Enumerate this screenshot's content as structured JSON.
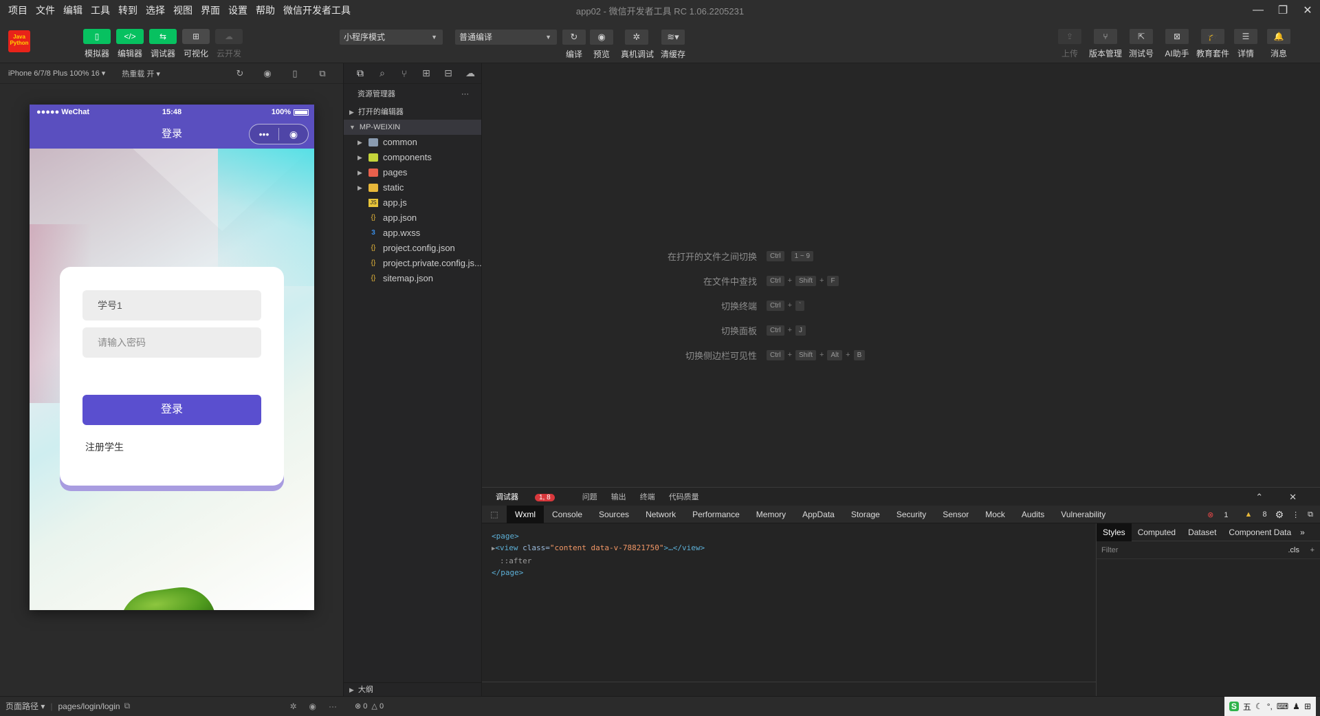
{
  "menubar": {
    "items": [
      "项目",
      "文件",
      "编辑",
      "工具",
      "转到",
      "选择",
      "视图",
      "界面",
      "设置",
      "帮助",
      "微信开发者工具"
    ],
    "title": "app02 - 微信开发者工具 RC 1.06.2205231"
  },
  "toolbar": {
    "logo_text": "Java Python",
    "simulator": "模拟器",
    "editor": "编辑器",
    "debugger": "调试器",
    "visual": "可视化",
    "cloud": "云开发",
    "mode_select": "小程序模式",
    "compile_select": "普通编译",
    "compile": "编译",
    "preview": "预览",
    "real_debug": "真机调试",
    "clear_cache": "清缓存",
    "upload": "上传",
    "version": "版本管理",
    "test_account": "测试号",
    "ai": "AI助手",
    "edu": "教育套件",
    "details": "详情",
    "messages": "消息"
  },
  "simulator": {
    "device": "iPhone 6/7/8 Plus 100% 16",
    "hot_reload": "热重载 开",
    "status_left": "●●●●● WeChat",
    "status_time": "15:48",
    "status_battery": "100%",
    "nav_title": "登录",
    "capsule_more": "•••",
    "capsule_close": "◉",
    "student_id_value": "学号1",
    "password_placeholder": "请输入密码",
    "login_button": "登录",
    "register_link": "注册学生"
  },
  "explorer": {
    "header": "资源管理器",
    "more": "···",
    "open_editors": "打开的编辑器",
    "project": "MP-WEIXIN",
    "items": [
      {
        "name": "common",
        "type": "folder",
        "color": "#8a9bb0"
      },
      {
        "name": "components",
        "type": "folder",
        "color": "#c4d43a"
      },
      {
        "name": "pages",
        "type": "folder",
        "color": "#e8604c"
      },
      {
        "name": "static",
        "type": "folder",
        "color": "#e8b83a"
      },
      {
        "name": "app.js",
        "type": "js",
        "color": "#e8c53a"
      },
      {
        "name": "app.json",
        "type": "json",
        "color": "#e8b83a"
      },
      {
        "name": "app.wxss",
        "type": "wxss",
        "color": "#3a8ee8"
      },
      {
        "name": "project.config.json",
        "type": "json",
        "color": "#e8b83a"
      },
      {
        "name": "project.private.config.js...",
        "type": "json",
        "color": "#e8b83a"
      },
      {
        "name": "sitemap.json",
        "type": "json",
        "color": "#e8b83a"
      }
    ],
    "outline": "大纲"
  },
  "shortcuts": [
    {
      "label": "在打开的文件之间切换",
      "keys": [
        "Ctrl",
        "1 ~ 9"
      ]
    },
    {
      "label": "在文件中查找",
      "keys": [
        "Ctrl",
        "+",
        "Shift",
        "+",
        "F"
      ]
    },
    {
      "label": "切换终端",
      "keys": [
        "Ctrl",
        "+",
        "`"
      ]
    },
    {
      "label": "切换面板",
      "keys": [
        "Ctrl",
        "+",
        "J"
      ]
    },
    {
      "label": "切换侧边栏可见性",
      "keys": [
        "Ctrl",
        "+",
        "Shift",
        "+",
        "Alt",
        "+",
        "B"
      ]
    }
  ],
  "debugger": {
    "top_tabs": [
      "调试器",
      "问题",
      "输出",
      "终端",
      "代码质量"
    ],
    "badge": "1, 8",
    "tabs": [
      "Wxml",
      "Console",
      "Sources",
      "Network",
      "Performance",
      "Memory",
      "AppData",
      "Storage",
      "Security",
      "Sensor",
      "Mock",
      "Audits",
      "Vulnerability"
    ],
    "errors": "1",
    "warnings": "8",
    "code": {
      "page_open": "<page>",
      "view_tag_open": "<view",
      "view_attr": " class=",
      "view_val": "\"content data-v-78821750\"",
      "view_rest": ">…</view>",
      "after": "::after",
      "page_close": "</page>"
    },
    "styles_tabs": [
      "Styles",
      "Computed",
      "Dataset",
      "Component Data"
    ],
    "filter_placeholder": "Filter",
    "cls": ".cls"
  },
  "statusbar": {
    "page_path_label": "页面路径",
    "page_path": "pages/login/login",
    "errors": "0",
    "warnings": "0",
    "ime": "五"
  }
}
